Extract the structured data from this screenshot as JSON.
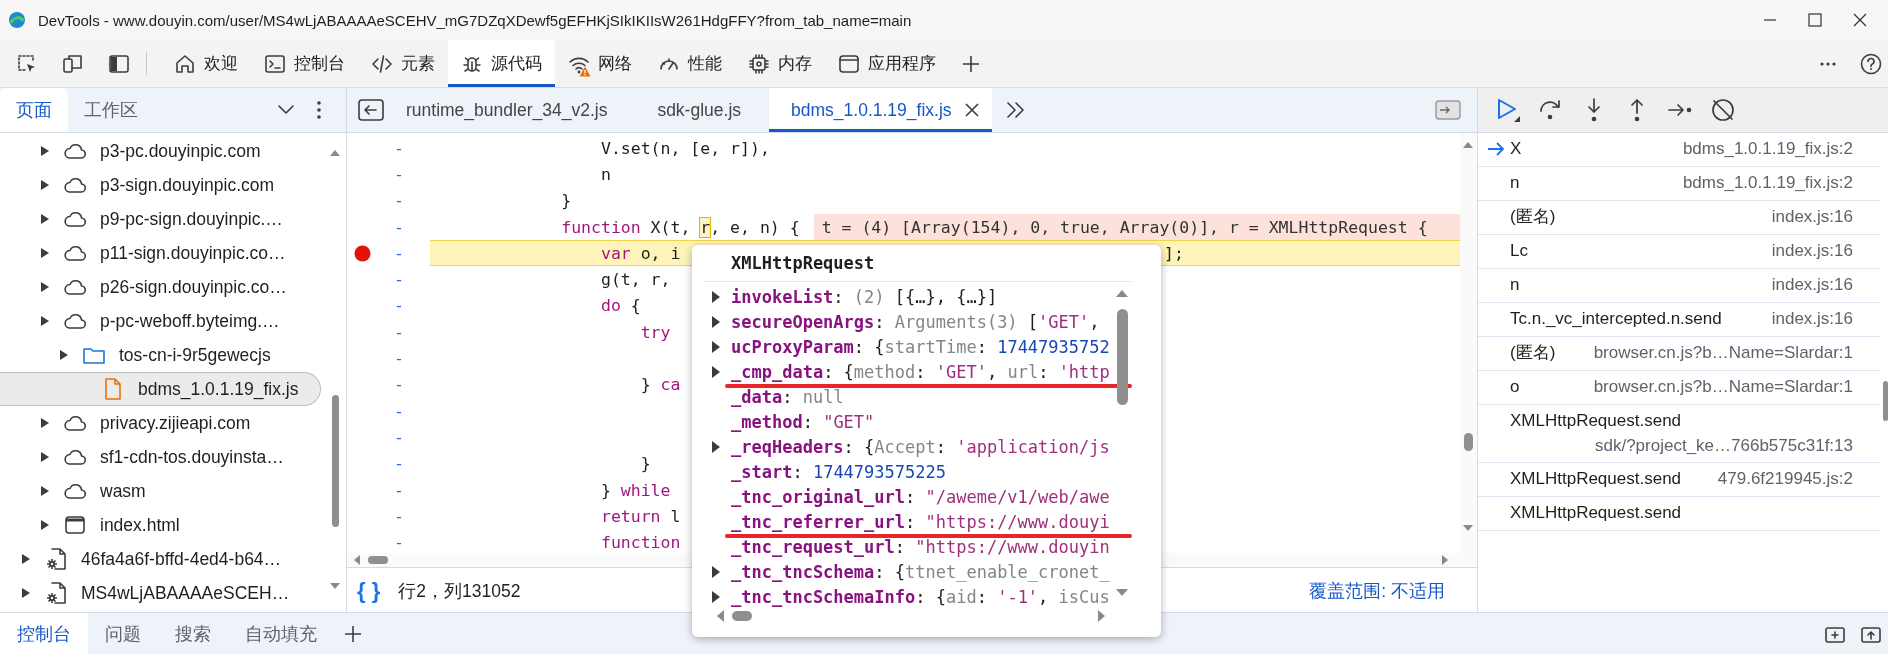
{
  "window": {
    "title": "DevTools - www.douyin.com/user/MS4wLjABAAAAeSCEHV_mG7DZqXDewf5gEFHKjSIkIKIIsW261HdgFFY?from_tab_name=main"
  },
  "panel_tabs": [
    {
      "label": "欢迎",
      "selected": false,
      "warning": false
    },
    {
      "label": "控制台",
      "selected": false,
      "warning": false
    },
    {
      "label": "元素",
      "selected": false,
      "warning": false
    },
    {
      "label": "源代码",
      "selected": true,
      "warning": false
    },
    {
      "label": "网络",
      "selected": false,
      "warning": true
    },
    {
      "label": "性能",
      "selected": false,
      "warning": false
    },
    {
      "label": "内存",
      "selected": false,
      "warning": false
    },
    {
      "label": "应用程序",
      "selected": false,
      "warning": false
    }
  ],
  "sidebar": {
    "tabs": [
      {
        "label": "页面",
        "selected": true
      },
      {
        "label": "工作区",
        "selected": false
      }
    ],
    "tree": [
      {
        "children": [
          {
            "label": "p3-pc.douyinpic.com",
            "kind": "domain",
            "selected": false
          },
          {
            "label": "p3-sign.douyinpic.com",
            "kind": "domain",
            "selected": false
          },
          {
            "label": "p9-pc-sign.douyinpic.…",
            "kind": "domain",
            "selected": false
          },
          {
            "label": "p11-sign.douyinpic.co…",
            "kind": "domain",
            "selected": false
          },
          {
            "label": "p26-sign.douyinpic.co…",
            "kind": "domain",
            "selected": false
          },
          {
            "label": "p-pc-weboff.byteimg.…",
            "kind": "domain",
            "selected": false,
            "children": [
              {
                "label": "tos-cn-i-9r5gewecjs",
                "kind": "folder",
                "selected": false,
                "children": [
                  {
                    "label": "bdms_1.0.1.19_fix.js",
                    "kind": "file",
                    "selected": true
                  }
                ]
              }
            ]
          },
          {
            "label": "privacy.zijieapi.com",
            "kind": "domain",
            "selected": false
          },
          {
            "label": "sf1-cdn-tos.douyinsta…",
            "kind": "domain",
            "selected": false
          },
          {
            "label": "wasm",
            "kind": "domain",
            "selected": false
          },
          {
            "label": "index.html",
            "kind": "document",
            "selected": false
          }
        ]
      },
      {
        "label": "46fa4a6f-bffd-4ed4-b64…",
        "kind": "extension",
        "selected": false
      },
      {
        "label": "MS4wLjABAAAAeSCEH…",
        "kind": "extension",
        "selected": false
      }
    ]
  },
  "editor": {
    "tabs": [
      {
        "label": "runtime_bundler_34_v2.js",
        "selected": false
      },
      {
        "label": "sdk-glue.js",
        "selected": false
      },
      {
        "label": "bdms_1.0.1.19_fix.js",
        "selected": true
      }
    ],
    "lines": [
      {
        "number": "-",
        "tokens": [
          {
            "kind": "plain",
            "text": "                V.set(n, [e, r]),"
          }
        ],
        "breakpoint": false,
        "current": false
      },
      {
        "number": "-",
        "tokens": [
          {
            "kind": "plain",
            "text": "                n"
          }
        ],
        "breakpoint": false,
        "current": false
      },
      {
        "number": "-",
        "tokens": [
          {
            "kind": "plain",
            "text": "            }"
          }
        ],
        "breakpoint": false,
        "current": false
      },
      {
        "number": "-",
        "tokens": [
          {
            "kind": "keyword",
            "text": "            function"
          },
          {
            "kind": "plain",
            "text": " X(t, "
          },
          {
            "kind": "hovered",
            "text": "r"
          },
          {
            "kind": "plain",
            "text": ", e, n) {"
          }
        ],
        "inline_value": "t = (4) [Array(154), 0, true, Array(0)], r = XMLHttpRequest {",
        "breakpoint": false,
        "current": false
      },
      {
        "number": "-",
        "tokens": [
          {
            "kind": "keyword",
            "text": "                var"
          },
          {
            "kind": "plain",
            "text": " o, i"
          }
        ],
        "tail": "];",
        "breakpoint": true,
        "current": true
      },
      {
        "number": "-",
        "tokens": [
          {
            "kind": "plain",
            "text": "                g(t, r,"
          }
        ],
        "breakpoint": false,
        "current": false
      },
      {
        "number": "-",
        "tokens": [
          {
            "kind": "keyword",
            "text": "                do"
          },
          {
            "kind": "plain",
            "text": " {"
          }
        ],
        "breakpoint": false,
        "current": false
      },
      {
        "number": "-",
        "tokens": [
          {
            "kind": "keyword",
            "text": "                    try"
          }
        ],
        "breakpoint": false,
        "current": false
      },
      {
        "number": "-",
        "breakpoint": false,
        "current": false
      },
      {
        "number": "-",
        "tokens": [
          {
            "kind": "plain",
            "text": "                    } "
          },
          {
            "kind": "keyword",
            "text": "ca"
          }
        ],
        "breakpoint": false,
        "current": false
      },
      {
        "number": "-",
        "breakpoint": false,
        "current": false
      },
      {
        "number": "-",
        "breakpoint": false,
        "current": false
      },
      {
        "number": "-",
        "tokens": [
          {
            "kind": "plain",
            "text": "                    }"
          }
        ],
        "breakpoint": false,
        "current": false
      },
      {
        "number": "-",
        "tokens": [
          {
            "kind": "plain",
            "text": "                } "
          },
          {
            "kind": "keyword",
            "text": "while"
          }
        ],
        "breakpoint": false,
        "current": false
      },
      {
        "number": "-",
        "tokens": [
          {
            "kind": "keyword",
            "text": "                return"
          },
          {
            "kind": "plain",
            "text": " l"
          }
        ],
        "breakpoint": false,
        "current": false
      },
      {
        "number": "-",
        "tokens": [
          {
            "kind": "keyword",
            "text": "                function"
          }
        ],
        "breakpoint": false,
        "current": false
      }
    ],
    "popover": {
      "title": "XMLHttpRequest",
      "rows": [
        {
          "key": "invokeList",
          "expandable": true,
          "underlined": false,
          "value": [
            {
              "kind": "plain",
              "text": ": "
            },
            {
              "kind": "dim",
              "text": "(2)"
            },
            {
              "kind": "plain",
              "text": " [{…}, {…}]"
            }
          ]
        },
        {
          "key": "secureOpenArgs",
          "expandable": true,
          "underlined": false,
          "value": [
            {
              "kind": "plain",
              "text": ": "
            },
            {
              "kind": "dim",
              "text": "Arguments(3)"
            },
            {
              "kind": "plain",
              "text": " ["
            },
            {
              "kind": "string",
              "text": "'GET'"
            },
            {
              "kind": "plain",
              "text": ","
            }
          ]
        },
        {
          "key": "ucProxyParam",
          "expandable": true,
          "underlined": false,
          "value": [
            {
              "kind": "plain",
              "text": ": {"
            },
            {
              "kind": "dim",
              "text": "startTime"
            },
            {
              "kind": "plain",
              "text": ": "
            },
            {
              "kind": "number",
              "text": "17447935752"
            }
          ]
        },
        {
          "key": "_cmp_data",
          "expandable": true,
          "underlined": true,
          "value": [
            {
              "kind": "plain",
              "text": ": {"
            },
            {
              "kind": "dim",
              "text": "method"
            },
            {
              "kind": "plain",
              "text": ": "
            },
            {
              "kind": "string",
              "text": "'GET'"
            },
            {
              "kind": "plain",
              "text": ", "
            },
            {
              "kind": "dim",
              "text": "url"
            },
            {
              "kind": "plain",
              "text": ": "
            },
            {
              "kind": "string",
              "text": "'http"
            }
          ]
        },
        {
          "key": "_data",
          "expandable": false,
          "underlined": false,
          "value": [
            {
              "kind": "plain",
              "text": ": "
            },
            {
              "kind": "dim",
              "text": "null"
            }
          ]
        },
        {
          "key": "_method",
          "expandable": false,
          "underlined": false,
          "value": [
            {
              "kind": "plain",
              "text": ": "
            },
            {
              "kind": "string",
              "text": "\"GET\""
            }
          ]
        },
        {
          "key": "_reqHeaders",
          "expandable": true,
          "underlined": false,
          "value": [
            {
              "kind": "plain",
              "text": ": {"
            },
            {
              "kind": "dim",
              "text": "Accept"
            },
            {
              "kind": "plain",
              "text": ": "
            },
            {
              "kind": "string",
              "text": "'application/js"
            }
          ]
        },
        {
          "key": "_start",
          "expandable": false,
          "underlined": false,
          "value": [
            {
              "kind": "plain",
              "text": ": "
            },
            {
              "kind": "number",
              "text": "1744793575225"
            }
          ]
        },
        {
          "key": "_tnc_original_url",
          "expandable": false,
          "underlined": false,
          "value": [
            {
              "kind": "plain",
              "text": ": "
            },
            {
              "kind": "string",
              "text": "\"/aweme/v1/web/awe"
            }
          ]
        },
        {
          "key": "_tnc_referrer_url",
          "expandable": false,
          "underlined": true,
          "value": [
            {
              "kind": "plain",
              "text": ": "
            },
            {
              "kind": "string",
              "text": "\"https://www.douyi"
            }
          ]
        },
        {
          "key": "_tnc_request_url",
          "expandable": false,
          "underlined": false,
          "value": [
            {
              "kind": "plain",
              "text": ": "
            },
            {
              "kind": "string",
              "text": "\"https://www.douyin"
            }
          ]
        },
        {
          "key": "_tnc_tncSchema",
          "expandable": true,
          "underlined": false,
          "value": [
            {
              "kind": "plain",
              "text": ": {"
            },
            {
              "kind": "dim",
              "text": "ttnet_enable_cronet_"
            }
          ]
        },
        {
          "key": "_tnc_tncSchemaInfo",
          "expandable": true,
          "underlined": false,
          "value": [
            {
              "kind": "plain",
              "text": ": {"
            },
            {
              "kind": "dim",
              "text": "aid"
            },
            {
              "kind": "plain",
              "text": ": "
            },
            {
              "kind": "string",
              "text": "'-1'"
            },
            {
              "kind": "plain",
              "text": ", "
            },
            {
              "kind": "dim",
              "text": "isCus"
            }
          ]
        }
      ]
    },
    "status": {
      "format_button": "{ }",
      "position": "行2，列131052",
      "coverage": "覆盖范围: 不适用"
    }
  },
  "call_stack": [
    {
      "name": "X",
      "location": "bdms_1.0.1.19_fix.js:2",
      "current": true
    },
    {
      "name": "n",
      "location": "bdms_1.0.1.19_fix.js:2",
      "current": false
    },
    {
      "name": "(匿名)",
      "location": "index.js:16",
      "current": false
    },
    {
      "name": "Lc",
      "location": "index.js:16",
      "current": false
    },
    {
      "name": "n",
      "location": "index.js:16",
      "current": false
    },
    {
      "name": "Tc.n._vc_intercepted.n.send",
      "location": "index.js:16",
      "current": false
    },
    {
      "name": "(匿名)",
      "location": "browser.cn.js?b…Name=Slardar:1",
      "current": false
    },
    {
      "name": "o",
      "location": "browser.cn.js?b…Name=Slardar:1",
      "current": false
    },
    {
      "name": "XMLHttpRequest.send",
      "location": "sdk/?project_ke…766b575c31f:13",
      "current": false
    },
    {
      "name": "XMLHttpRequest.send",
      "location": "479.6f219945.js:2",
      "current": false
    },
    {
      "name": "XMLHttpRequest.send",
      "current": false
    }
  ],
  "drawer": {
    "tabs": [
      {
        "label": "控制台",
        "selected": true
      },
      {
        "label": "问题",
        "selected": false
      },
      {
        "label": "搜索",
        "selected": false
      },
      {
        "label": "自动填充",
        "selected": false
      }
    ]
  }
}
